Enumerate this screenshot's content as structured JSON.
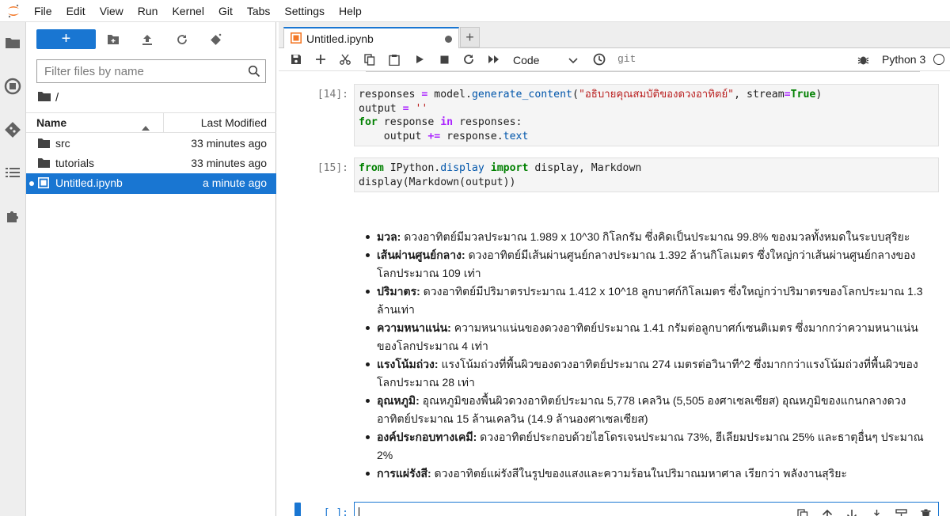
{
  "menubar": {
    "items": [
      "File",
      "Edit",
      "View",
      "Run",
      "Kernel",
      "Git",
      "Tabs",
      "Settings",
      "Help"
    ]
  },
  "activity_bar": [
    "folder-icon",
    "running-icon",
    "git-icon",
    "toc-icon",
    "extension-icon"
  ],
  "file_browser": {
    "new_label": "+",
    "filter_placeholder": "Filter files by name",
    "breadcrumb": "/",
    "columns": {
      "name": "Name",
      "modified": "Last Modified"
    },
    "files": [
      {
        "name": "src",
        "modified": "33 minutes ago",
        "type": "folder"
      },
      {
        "name": "tutorials",
        "modified": "33 minutes ago",
        "type": "folder"
      },
      {
        "name": "Untitled.ipynb",
        "modified": "a minute ago",
        "type": "notebook",
        "selected": true
      }
    ]
  },
  "tab": {
    "title": "Untitled.ipynb"
  },
  "notebook_toolbar": {
    "cell_type": "Code",
    "git": "git",
    "kernel": "Python 3"
  },
  "cells": [
    {
      "prompt": "[14]:",
      "lines": [
        "responses = model.generate_content(\"อธิบายคุณสมบัติของดวงอาทิตย์\", stream=True)",
        "output = ''",
        "for response in responses:",
        "    output += response.text"
      ]
    },
    {
      "prompt": "[15]:",
      "lines": [
        "from IPython.display import display, Markdown",
        "display(Markdown(output))"
      ]
    }
  ],
  "markdown_output": [
    {
      "term": "มวล:",
      "text": "ดวงอาทิตย์มีมวลประมาณ 1.989 x 10^30 กิโลกรัม ซึ่งคิดเป็นประมาณ 99.8% ของมวลทั้งหมดในระบบสุริยะ"
    },
    {
      "term": "เส้นผ่านศูนย์กลาง:",
      "text": "ดวงอาทิตย์มีเส้นผ่านศูนย์กลางประมาณ 1.392 ล้านกิโลเมตร ซึ่งใหญ่กว่าเส้นผ่านศูนย์กลางของโลกประมาณ 109 เท่า"
    },
    {
      "term": "ปริมาตร:",
      "text": "ดวงอาทิตย์มีปริมาตรประมาณ 1.412 x 10^18 ลูกบาศก์กิโลเมตร ซึ่งใหญ่กว่าปริมาตรของโลกประมาณ 1.3 ล้านเท่า"
    },
    {
      "term": "ความหนาแน่น:",
      "text": "ความหนาแน่นของดวงอาทิตย์ประมาณ 1.41 กรัมต่อลูกบาศก์เซนติเมตร ซึ่งมากกว่าความหนาแน่นของโลกประมาณ 4 เท่า"
    },
    {
      "term": "แรงโน้มถ่วง:",
      "text": "แรงโน้มถ่วงที่พื้นผิวของดวงอาทิตย์ประมาณ 274 เมตรต่อวินาที^2 ซึ่งมากกว่าแรงโน้มถ่วงที่พื้นผิวของโลกประมาณ 28 เท่า"
    },
    {
      "term": "อุณหภูมิ:",
      "text": "อุณหภูมิของพื้นผิวดวงอาทิตย์ประมาณ 5,778 เคลวิน (5,505 องศาเซลเซียส) อุณหภูมิของแกนกลางดวงอาทิตย์ประมาณ 15 ล้านเคลวิน (14.9 ล้านองศาเซลเซียส)"
    },
    {
      "term": "องค์ประกอบทางเคมี:",
      "text": "ดวงอาทิตย์ประกอบด้วยไฮโดรเจนประมาณ 73%, ฮีเลียมประมาณ 25% และธาตุอื่นๆ ประมาณ 2%"
    },
    {
      "term": "การแผ่รังสี:",
      "text": "ดวงอาทิตย์แผ่รังสีในรูปของแสงและความร้อนในปริมาณมหาศาล เรียกว่า พลังงานสุริยะ"
    }
  ],
  "active_cell": {
    "prompt": "[ ]:"
  },
  "colors": {
    "accent": "#1976d2",
    "jupyter_orange": "#f37726"
  }
}
